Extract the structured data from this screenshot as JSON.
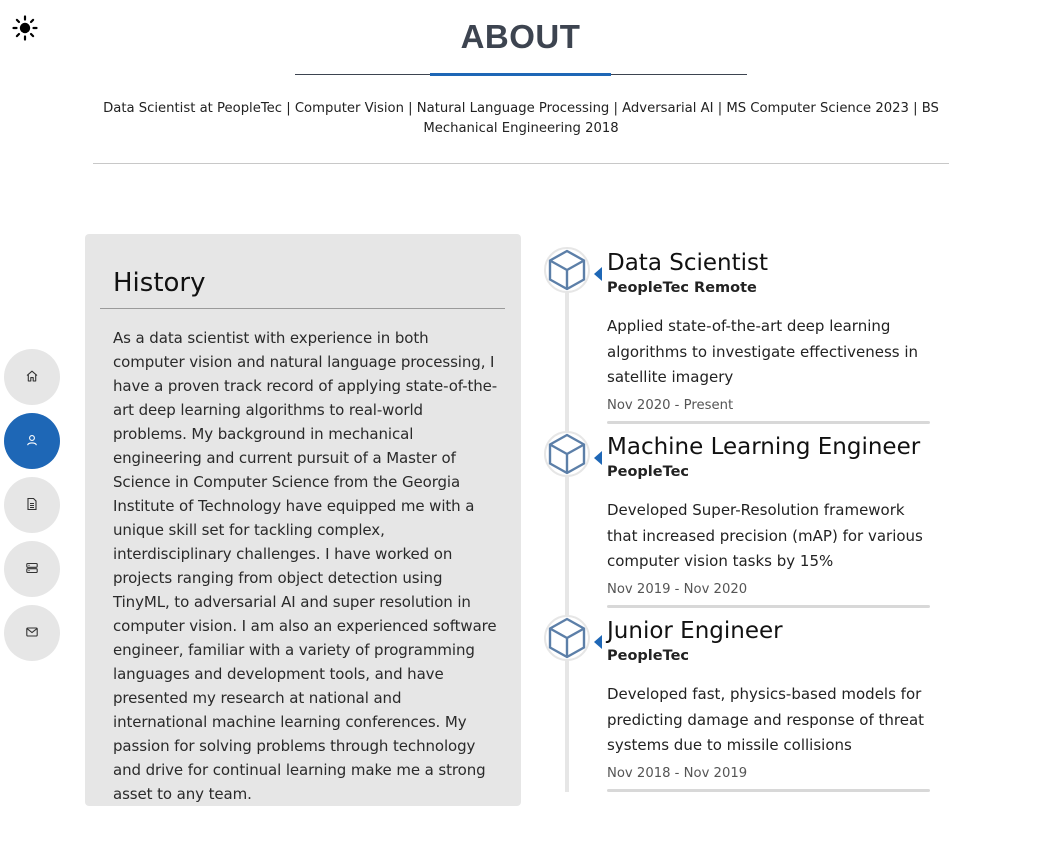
{
  "theme_toggle": {
    "icon": "sun-icon"
  },
  "header": {
    "title": "ABOUT",
    "subtitle": "Data Scientist at PeopleTec | Computer Vision | Natural Language Processing | Adversarial AI | MS Computer Science 2023 | BS Mechanical Engineering 2018",
    "accent_color": "#1e67b6"
  },
  "sidenav": {
    "items": [
      {
        "icon": "home-icon",
        "active": false
      },
      {
        "icon": "user-icon",
        "active": true
      },
      {
        "icon": "document-icon",
        "active": false
      },
      {
        "icon": "server-icon",
        "active": false
      },
      {
        "icon": "mail-icon",
        "active": false
      }
    ]
  },
  "history": {
    "heading": "History",
    "body": "As a data scientist with experience in both computer vision and natural language processing, I have a proven track record of applying state-of-the-art deep learning algorithms to real-world problems. My background in mechanical engineering and current pursuit of a Master of Science in Computer Science from the Georgia Institute of Technology have equipped me with a unique skill set for tackling complex, interdisciplinary challenges. I have worked on projects ranging from object detection using TinyML, to adversarial AI and super resolution in computer vision. I am also an experienced software engineer, familiar with a variety of programming languages and development tools, and have presented my research at national and international machine learning conferences. My passion for solving problems through technology and drive for continual learning make me a strong asset to any team."
  },
  "timeline": [
    {
      "icon": "cube-icon",
      "title": "Data Scientist",
      "company": "PeopleTec Remote",
      "description": "Applied state-of-the-art deep learning algorithms to investigate effectiveness in satellite imagery",
      "dates": "Nov 2020 - Present"
    },
    {
      "icon": "cube-icon",
      "title": "Machine Learning Engineer",
      "company": "PeopleTec",
      "description": "Developed Super-Resolution framework that increased precision (mAP) for various computer vision tasks by 15%",
      "dates": "Nov 2019 - Nov 2020"
    },
    {
      "icon": "cube-icon",
      "title": "Junior Engineer",
      "company": "PeopleTec",
      "description": "Developed fast, physics-based models for predicting damage and response of threat systems due to missile collisions",
      "dates": "Nov 2018 - Nov 2019"
    }
  ]
}
